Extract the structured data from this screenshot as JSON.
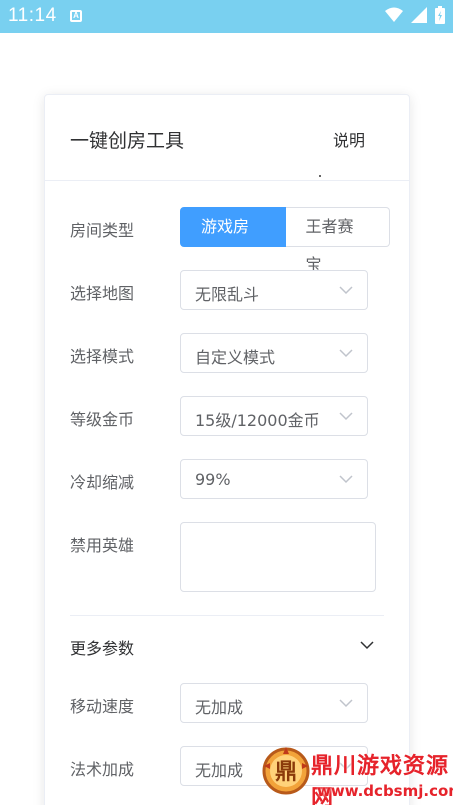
{
  "status_bar": {
    "time": "11:14",
    "notification_icon": "A",
    "icons": [
      "wifi-icon",
      "signal-icon",
      "battery-icon"
    ],
    "background": "#79d0f0"
  },
  "card": {
    "title": "一键创房工具",
    "link": "说明"
  },
  "form": {
    "room_type": {
      "label": "房间类型",
      "options": [
        "游戏房间",
        "王者赛宝"
      ],
      "selected": "游戏房间",
      "accent": "#409eff"
    },
    "map": {
      "label": "选择地图",
      "value": "无限乱斗"
    },
    "mode": {
      "label": "选择模式",
      "value": "自定义模式"
    },
    "level_gold": {
      "label": "等级金币",
      "value": "15级/12000金币"
    },
    "cooldown": {
      "label": "冷却缩减",
      "value": "99%"
    },
    "ban_heroes": {
      "label": "禁用英雄",
      "value": ""
    },
    "more_params": {
      "title": "更多参数",
      "expanded": true
    },
    "move_speed": {
      "label": "移动速度",
      "value": "无加成"
    },
    "magic_bonus": {
      "label": "法术加成",
      "value": "无加成"
    }
  },
  "watermark": {
    "logo_char": "鼎",
    "text": "鼎川游戏资源网",
    "url": "www.dcbsmj.com"
  }
}
